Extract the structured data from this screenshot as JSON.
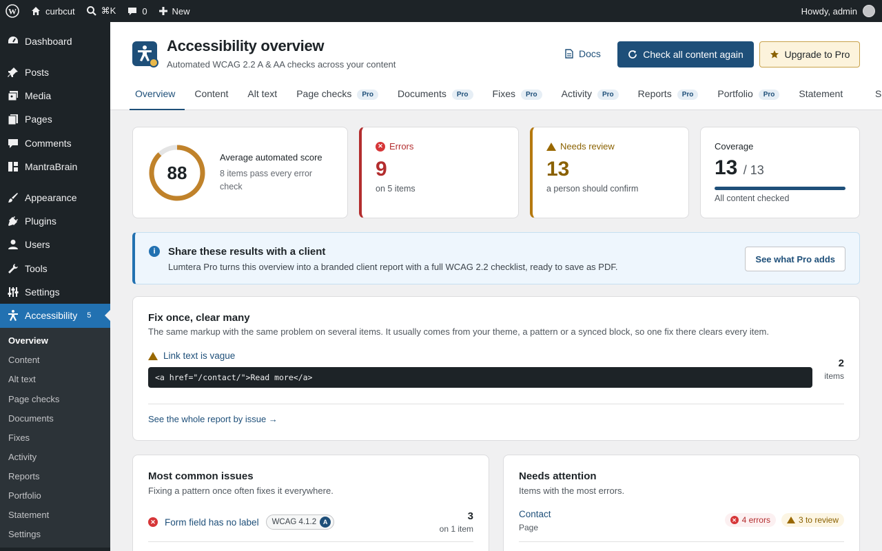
{
  "adminbar": {
    "site_name": "curbcut",
    "search_shortcut": "⌘K",
    "comments_count": "0",
    "new_label": "New",
    "greeting": "Howdy, admin"
  },
  "sidebar": {
    "items": [
      {
        "label": "Dashboard",
        "icon": "dashboard-icon"
      },
      {
        "label": "Posts",
        "icon": "pin-icon"
      },
      {
        "label": "Media",
        "icon": "media-icon"
      },
      {
        "label": "Pages",
        "icon": "page-icon"
      },
      {
        "label": "Comments",
        "icon": "comment-icon"
      },
      {
        "label": "MantraBrain",
        "icon": "grid-icon"
      },
      {
        "label": "Appearance",
        "icon": "brush-icon"
      },
      {
        "label": "Plugins",
        "icon": "plug-icon"
      },
      {
        "label": "Users",
        "icon": "user-icon"
      },
      {
        "label": "Tools",
        "icon": "wrench-icon"
      },
      {
        "label": "Settings",
        "icon": "sliders-icon"
      },
      {
        "label": "Accessibility",
        "icon": "accessibility-icon",
        "count": "5"
      }
    ],
    "submenu": [
      "Overview",
      "Content",
      "Alt text",
      "Page checks",
      "Documents",
      "Fixes",
      "Activity",
      "Reports",
      "Portfolio",
      "Statement",
      "Settings"
    ]
  },
  "header": {
    "title": "Accessibility overview",
    "subtitle": "Automated WCAG 2.2 A & AA checks across your content",
    "docs_label": "Docs",
    "recheck_label": "Check all content again",
    "upgrade_label": "Upgrade to Pro",
    "pro_badge": "Pro",
    "tabs": [
      {
        "label": "Overview",
        "pro": false
      },
      {
        "label": "Content",
        "pro": false
      },
      {
        "label": "Alt text",
        "pro": false
      },
      {
        "label": "Page checks",
        "pro": true
      },
      {
        "label": "Documents",
        "pro": true
      },
      {
        "label": "Fixes",
        "pro": true
      },
      {
        "label": "Activity",
        "pro": true
      },
      {
        "label": "Reports",
        "pro": true
      },
      {
        "label": "Portfolio",
        "pro": true
      },
      {
        "label": "Statement",
        "pro": false
      },
      {
        "label": "Se",
        "pro": false
      }
    ]
  },
  "score": {
    "value": "88",
    "fraction": 0.88,
    "label": "Average automated score",
    "sub": "8 items pass every error check"
  },
  "errors": {
    "title": "Errors",
    "value": "9",
    "sub": "on 5 items"
  },
  "review": {
    "title": "Needs review",
    "value": "13",
    "sub": "a person should confirm"
  },
  "coverage": {
    "title": "Coverage",
    "value": "13",
    "total": "/ 13",
    "fraction": 1.0,
    "sub": "All content checked"
  },
  "notice": {
    "title": "Share these results with a client",
    "text": "Lumtera Pro turns this overview into a branded client report with a full WCAG 2.2 checklist, ready to save as PDF.",
    "button": "See what Pro adds"
  },
  "fix_once": {
    "title": "Fix once, clear many",
    "sub": "The same markup with the same problem on several items. It usually comes from your theme, a pattern or a synced block, so one fix there clears every item.",
    "issue": "Link text is vague",
    "code": "<a href=\"/contact/\">Read more</a>",
    "count": "2",
    "count_unit": "items",
    "report_link": "See the whole report by issue →"
  },
  "common": {
    "title": "Most common issues",
    "sub": "Fixing a pattern once often fixes it everywhere.",
    "row": {
      "label": "Form field has no label",
      "wcag": "WCAG 4.1.2",
      "level": "A",
      "count": "3",
      "where": "on 1 item"
    }
  },
  "attention": {
    "title": "Needs attention",
    "sub": "Items with the most errors.",
    "row": {
      "label": "Contact",
      "type": "Page",
      "errors": "4 errors",
      "review": "3 to review"
    }
  },
  "colors": {
    "accent": "#1e4f79",
    "error": "#d63638",
    "warning": "#b5790f",
    "wp_dark": "#1d2327",
    "wp_blue": "#2271b1"
  }
}
